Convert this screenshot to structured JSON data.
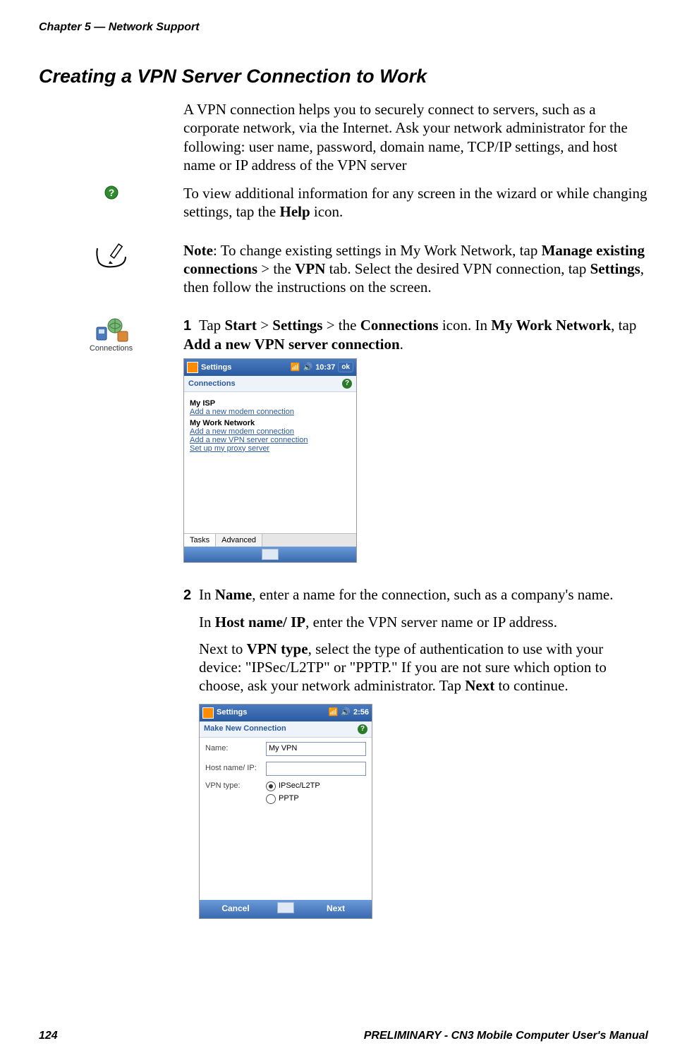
{
  "running_head": "Chapter 5 — Network Support",
  "heading": "Creating a VPN Server Connection to Work",
  "intro": "A VPN connection helps you to securely connect to servers, such as a corporate network, via the Internet. Ask your network administrator for the following: user name, password, domain name, TCP/IP settings, and host name or IP address of the VPN server",
  "tip": {
    "pre": "To view additional information for any screen in the wizard or while changing settings, tap the ",
    "b1": "Help",
    "post": " icon."
  },
  "note": {
    "label": "Note",
    "t1": ": To change existing settings in My Work Network, tap ",
    "b1": "Manage existing connections",
    "t2": " > the ",
    "b2": "VPN",
    "t3": " tab. Select the desired VPN connection, tap ",
    "b3": "Settings",
    "t4": ", then follow the instructions on the screen."
  },
  "conn_icon_label": "Connections",
  "steps": {
    "s1": {
      "num": "1",
      "t1": "Tap ",
      "b1": "Start",
      "t2": " > ",
      "b2": "Settings",
      "t3": " > the ",
      "b3": "Connections",
      "t4": " icon. In ",
      "b4": "My Work Network",
      "t5": ", tap ",
      "b5": "Add a new VPN server connection",
      "t6": "."
    },
    "s2": {
      "num": "2",
      "p1_t1": "In ",
      "p1_b1": "Name",
      "p1_t2": ", enter a name for the connection, such as a company's name.",
      "p2_t1": "In ",
      "p2_b1": "Host name/ IP",
      "p2_t2": ", enter the VPN server name or IP address.",
      "p3_t1": "Next to ",
      "p3_b1": "VPN type",
      "p3_t2": ", select the type of authentication to use with your device: \"IPSec/L2TP\" or \"PPTP.\" If you are not sure which option to choose, ask your network administrator. Tap ",
      "p3_b2": "Next",
      "p3_t3": " to continue."
    }
  },
  "mock1": {
    "title": "Settings",
    "time": "10:37",
    "ok": "ok",
    "subtitle": "Connections",
    "group1": "My ISP",
    "g1_link1": "Add a new modem connection",
    "group2": "My Work Network",
    "g2_link1": "Add a new modem connection",
    "g2_link2": "Add a new VPN server connection",
    "g2_link3": "Set up my proxy server",
    "tab1": "Tasks",
    "tab2": "Advanced"
  },
  "mock2": {
    "title": "Settings",
    "time": "2:56",
    "subtitle": "Make New Connection",
    "label_name": "Name:",
    "val_name": "My VPN",
    "label_host": "Host name/ IP:",
    "val_host": "",
    "label_vpntype": "VPN type:",
    "radio1": "IPSec/L2TP",
    "radio2": "PPTP",
    "soft_left": "Cancel",
    "soft_right": "Next"
  },
  "footer": {
    "page": "124",
    "right": "PRELIMINARY - CN3 Mobile Computer User's Manual"
  }
}
